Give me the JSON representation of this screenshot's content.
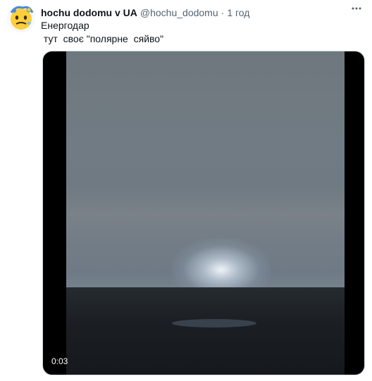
{
  "tweet": {
    "author_name": "hochu dodomu v UA",
    "author_handle": "@hochu_dodomu",
    "separator": "·",
    "timestamp": "1 год",
    "text_line1": "Енергодар",
    "text_line2": " тут  своє \"полярне  сяйво\"",
    "more_icon": "more-horizontal-icon"
  },
  "video": {
    "duration": "0:03"
  }
}
